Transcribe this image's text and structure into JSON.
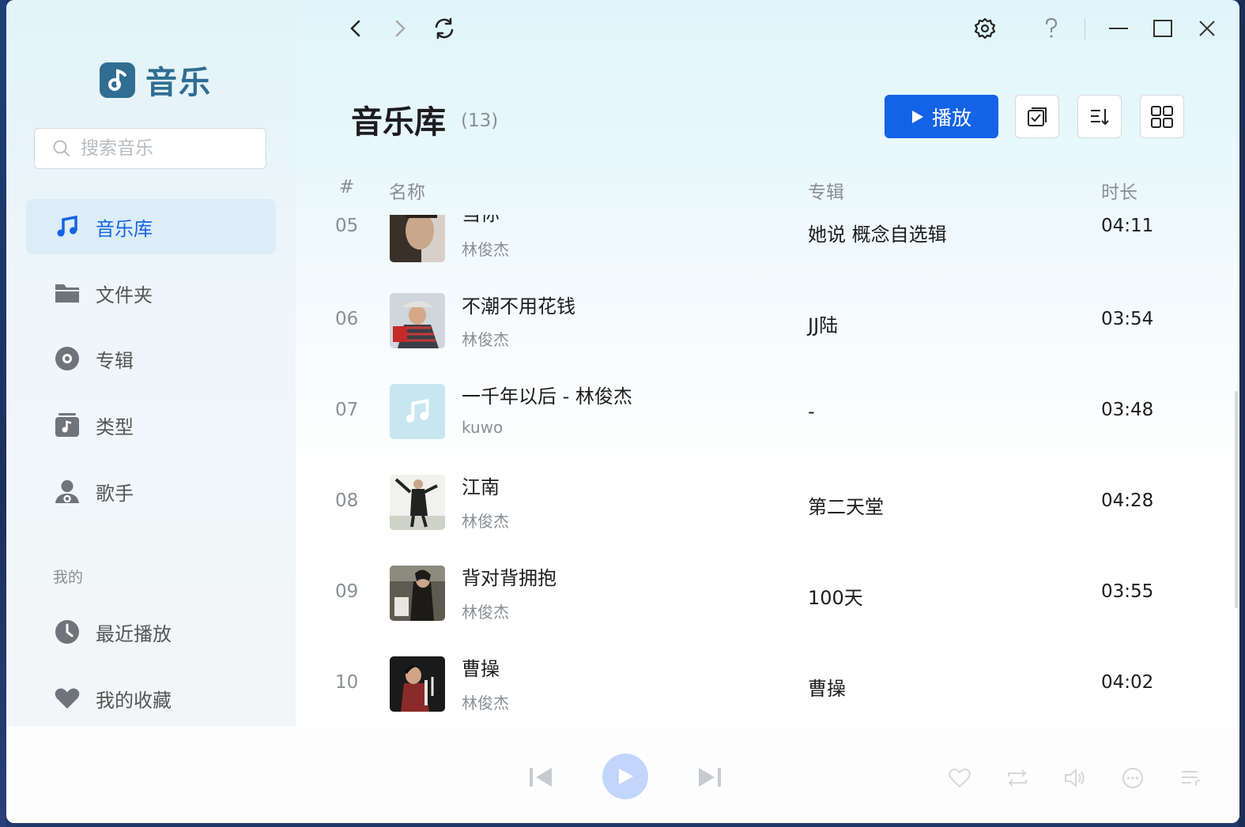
{
  "app": {
    "name": "音乐"
  },
  "search": {
    "placeholder": "搜索音乐"
  },
  "sidebar": {
    "items": [
      {
        "label": "音乐库",
        "icon": "music-note-icon",
        "active": true
      },
      {
        "label": "文件夹",
        "icon": "folder-icon"
      },
      {
        "label": "专辑",
        "icon": "album-disc-icon"
      },
      {
        "label": "类型",
        "icon": "genre-icon"
      },
      {
        "label": "歌手",
        "icon": "singer-icon"
      }
    ],
    "section_label": "我的",
    "my_items": [
      {
        "label": "最近播放",
        "icon": "clock-icon"
      },
      {
        "label": "我的收藏",
        "icon": "heart-icon"
      }
    ]
  },
  "main": {
    "title": "音乐库",
    "count": "(13)",
    "play_label": "播放",
    "columns": {
      "num": "#",
      "name": "名称",
      "album": "专辑",
      "duration": "时长"
    }
  },
  "tracks": [
    {
      "num": "05",
      "name": "当你",
      "artist": "林俊杰",
      "album": "她说 概念自选辑",
      "duration": "04:11"
    },
    {
      "num": "06",
      "name": "不潮不用花钱",
      "artist": "林俊杰",
      "album": "JJ陆",
      "duration": "03:54"
    },
    {
      "num": "07",
      "name": "一千年以后 - 林俊杰",
      "artist": "kuwo",
      "album": "-",
      "duration": "03:48"
    },
    {
      "num": "08",
      "name": "江南",
      "artist": "林俊杰",
      "album": "第二天堂",
      "duration": "04:28"
    },
    {
      "num": "09",
      "name": "背对背拥抱",
      "artist": "林俊杰",
      "album": "100天",
      "duration": "03:55"
    },
    {
      "num": "10",
      "name": "曹操",
      "artist": "林俊杰",
      "album": "曹操",
      "duration": "04:02"
    }
  ],
  "colors": {
    "accent": "#1463e6",
    "brand": "#2f6e92"
  }
}
